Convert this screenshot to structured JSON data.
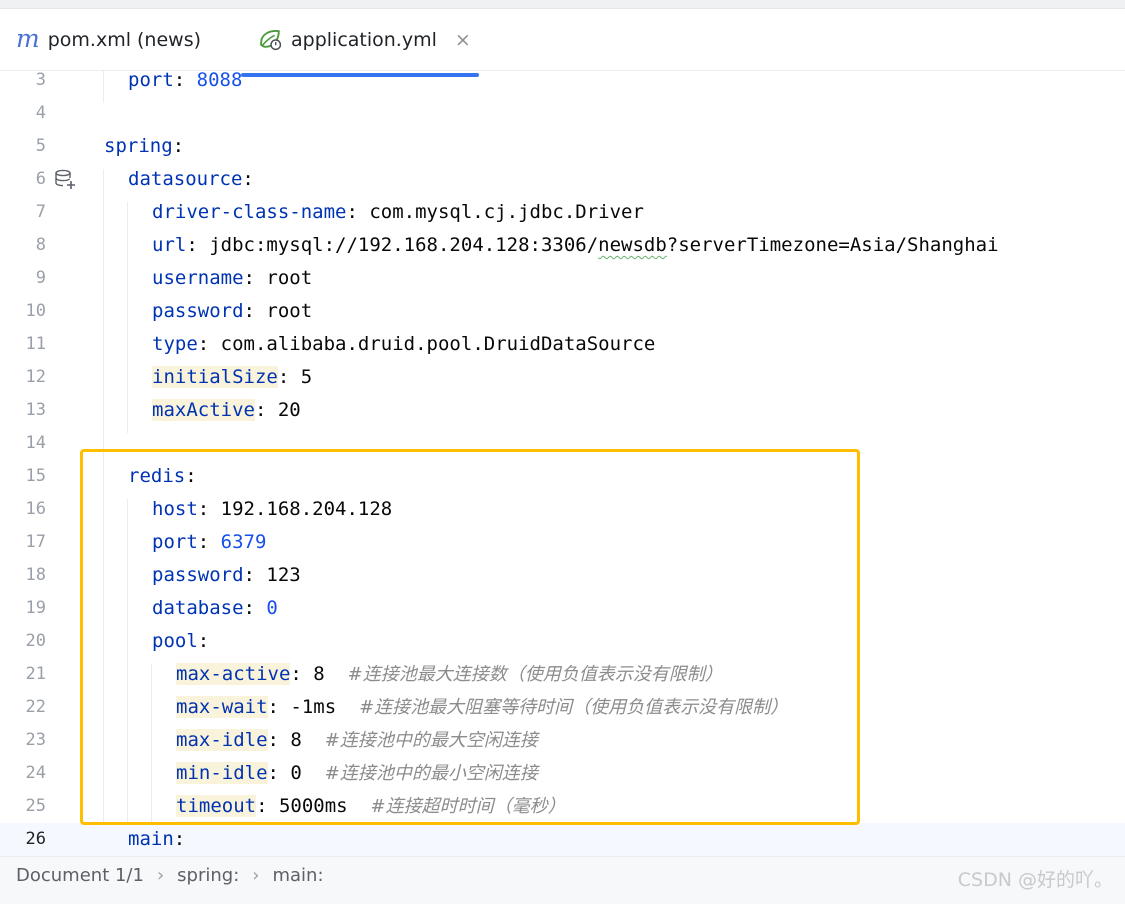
{
  "tabs": [
    {
      "label": "pom.xml (news)",
      "icon": "maven-m-icon",
      "active": false
    },
    {
      "label": "application.yml",
      "icon": "spring-leaf-icon",
      "active": true,
      "close": "×"
    }
  ],
  "colors": {
    "key": "#0033b3",
    "number": "#1750eb",
    "comment": "#8c8c8c",
    "highlight_box": "#ffbf00",
    "tab_underline": "#3574f0"
  },
  "editor": {
    "current_line": "26",
    "lines": [
      {
        "n": "3",
        "key": "port",
        "sep": ": ",
        "val": "8088"
      },
      {
        "n": "4"
      },
      {
        "n": "5",
        "key": "spring",
        "sep": ":"
      },
      {
        "n": "6",
        "key": "datasource",
        "sep": ":"
      },
      {
        "n": "7",
        "key": "driver-class-name",
        "sep": ": ",
        "val": "com.mysql.cj.jdbc.Driver"
      },
      {
        "n": "8",
        "key": "url",
        "sep": ": ",
        "val_a": "jdbc:mysql://192.168.204.128:3306/",
        "val_b": "newsdb",
        "val_c": "?serverTimezone=Asia/Shanghai"
      },
      {
        "n": "9",
        "key": "username",
        "sep": ": ",
        "val": "root"
      },
      {
        "n": "10",
        "key": "password",
        "sep": ": ",
        "val": "root"
      },
      {
        "n": "11",
        "key": "type",
        "sep": ": ",
        "val": "com.alibaba.druid.pool.DruidDataSource"
      },
      {
        "n": "12",
        "key": "initialSize",
        "sep": ": ",
        "val": "5"
      },
      {
        "n": "13",
        "key": "maxActive",
        "sep": ": ",
        "val": "20"
      },
      {
        "n": "14"
      },
      {
        "n": "15",
        "key": "redis",
        "sep": ":"
      },
      {
        "n": "16",
        "key": "host",
        "sep": ": ",
        "val": "192.168.204.128"
      },
      {
        "n": "17",
        "key": "port",
        "sep": ": ",
        "val": "6379"
      },
      {
        "n": "18",
        "key": "password",
        "sep": ": ",
        "val": "123"
      },
      {
        "n": "19",
        "key": "database",
        "sep": ": ",
        "val": "0"
      },
      {
        "n": "20",
        "key": "pool",
        "sep": ":"
      },
      {
        "n": "21",
        "key": "max-active",
        "sep": ": ",
        "val": "8",
        "comment": "#连接池最大连接数（使用负值表示没有限制）"
      },
      {
        "n": "22",
        "key": "max-wait",
        "sep": ": ",
        "val": "-1ms",
        "comment": "#连接池最大阻塞等待时间（使用负值表示没有限制）"
      },
      {
        "n": "23",
        "key": "max-idle",
        "sep": ": ",
        "val": "8",
        "comment": "#连接池中的最大空闲连接"
      },
      {
        "n": "24",
        "key": "min-idle",
        "sep": ": ",
        "val": "0",
        "comment": "#连接池中的最小空闲连接"
      },
      {
        "n": "25",
        "key": "timeout",
        "sep": ": ",
        "val": "5000ms",
        "comment": "#连接超时时间（毫秒）"
      },
      {
        "n": "26",
        "key": "main",
        "sep": ":"
      }
    ]
  },
  "status": {
    "breadcrumb": [
      "Document 1/1",
      "spring:",
      "main:"
    ],
    "separator": "›",
    "watermark": "CSDN @好的吖。"
  }
}
